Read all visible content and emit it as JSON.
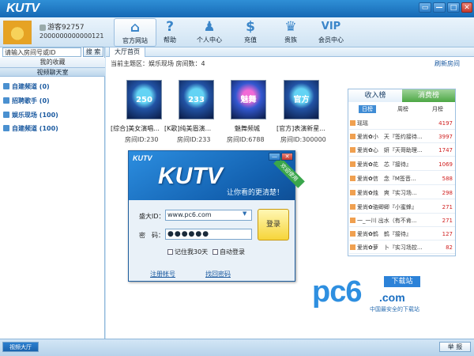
{
  "app": {
    "logo": "KUTV"
  },
  "window_controls": {
    "skin": "▭",
    "minimize": "—",
    "maximize": "□",
    "close": "✕"
  },
  "user": {
    "name": "游客92757",
    "id": "2000000000000121"
  },
  "nav": [
    {
      "label": "官方网站",
      "icon": "home-icon",
      "glyph": "⌂"
    },
    {
      "label": "帮助",
      "icon": "help-icon",
      "glyph": "?"
    },
    {
      "label": "个人中心",
      "icon": "person-icon",
      "glyph": "♟"
    },
    {
      "label": "充值",
      "icon": "dollar-icon",
      "glyph": "$"
    },
    {
      "label": "贵族",
      "icon": "crown-icon",
      "glyph": "♛"
    },
    {
      "label": "会员中心",
      "icon": "vip-icon",
      "glyph": "VIP"
    }
  ],
  "search": {
    "value": "请输入房间号或ID",
    "button": "搜 索"
  },
  "left": {
    "favorites": "我的收藏",
    "section": "视频聊天室",
    "channels": [
      "自建频道 (0)",
      "招聘歌手 (0)",
      "娱乐现场 (100)",
      "自建频道 (100)"
    ]
  },
  "main": {
    "tab": "大厅首页",
    "zone": "当前主题区：娱乐现场  房间数：4",
    "refresh": "刷新房间",
    "rooms": [
      {
        "thumb": "250",
        "name": "[综合]美女演唱...",
        "id": "房间ID:230"
      },
      {
        "thumb": "233",
        "name": "[K歌]纯美眉演...",
        "id": "房间ID:233"
      },
      {
        "thumb": "魅舞",
        "name": "魅舞频城",
        "id": "房间ID:6788"
      },
      {
        "thumb": "官方",
        "name": "[官方]表演新星...",
        "id": "房间ID:300000"
      }
    ]
  },
  "ranking": {
    "tabs": [
      "收入榜",
      "消费榜"
    ],
    "periods": [
      "日榜",
      "周榜",
      "月榜"
    ],
    "rows": [
      {
        "name": "瑶瑶",
        "value": "4197"
      },
      {
        "name": "爱尚✿小　天『签约接待...",
        "value": "3997"
      },
      {
        "name": "爱尚✿心　妍『天哥助理...",
        "value": "1747"
      },
      {
        "name": "爱尚✿花　芯『接待』",
        "value": "1069"
      },
      {
        "name": "爱尚✿信　念『M签音...",
        "value": "588"
      },
      {
        "name": "爱尚✿烛　爽『实习场...",
        "value": "298"
      },
      {
        "name": "爱尚✿骆卿卿『小蜜蜂』",
        "value": "271"
      },
      {
        "name": "一_一川 出水（有不肯...",
        "value": "271"
      },
      {
        "name": "爱尚✿鹤　鹤『接待』",
        "value": "127"
      },
      {
        "name": "爱尚✿萝　卜『实习场控...",
        "value": "82"
      }
    ]
  },
  "login": {
    "logo_small": "KUTV",
    "logo_big": "KUTV",
    "slogan": "让你看的更清楚！",
    "ribbon": "欢迎使用",
    "user_label": "盛大ID：",
    "user_value": "www.pc6.com",
    "pwd_label": "密　码：",
    "pwd_value": "●●●●●●",
    "login_button": "登录",
    "remember": "记住我30天",
    "auto_login": "自动登录",
    "register": "注册帐号",
    "retrieve": "找回密码"
  },
  "watermark": {
    "brand": "pc6",
    "domain": ".com",
    "download": "下载站",
    "tagline": "中国最安全的下载站"
  },
  "statusbar": {
    "left": "视频大厅",
    "report": "举 报"
  }
}
